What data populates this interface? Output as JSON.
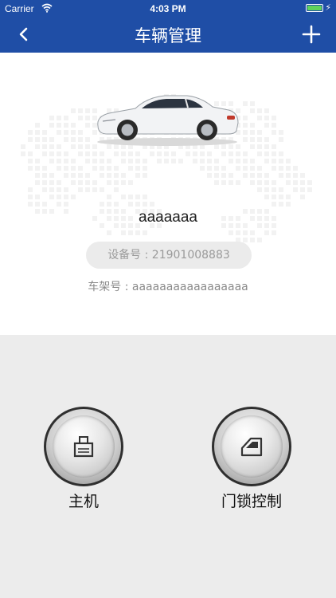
{
  "status": {
    "carrier": "Carrier",
    "time": "4:03 PM"
  },
  "nav": {
    "title": "车辆管理"
  },
  "vehicle": {
    "name": "aaaaaaa",
    "device_label": "设备号 : 21901008883",
    "frame_label": "车架号 : aaaaaaaaaaaaaaaaa"
  },
  "controls": [
    {
      "label": "主机",
      "icon": "host-device-icon"
    },
    {
      "label": "门锁控制",
      "icon": "car-door-icon"
    }
  ],
  "colors": {
    "nav_background": "#1f4ea6",
    "page_background": "#ececec"
  }
}
